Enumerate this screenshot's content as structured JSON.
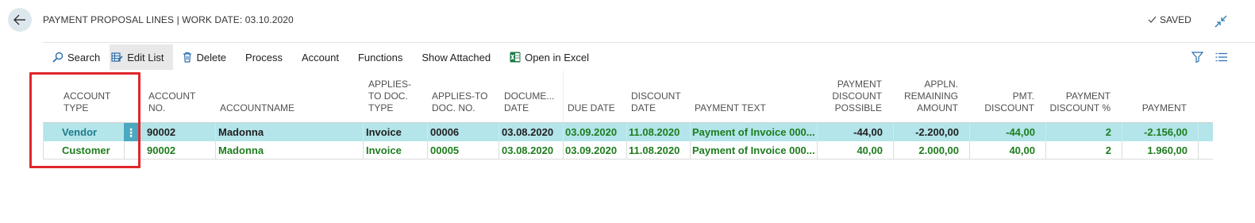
{
  "header": {
    "title": "PAYMENT PROPOSAL LINES | WORK DATE: 03.10.2020",
    "saved_label": "SAVED"
  },
  "toolbar": {
    "search": "Search",
    "edit_list": "Edit List",
    "delete": "Delete",
    "process": "Process",
    "account": "Account",
    "functions": "Functions",
    "show_attached": "Show Attached",
    "open_in_excel": "Open in Excel"
  },
  "columns": {
    "account_type": [
      "ACCOUNT",
      "TYPE"
    ],
    "account_no": [
      "ACCOUNT",
      "NO."
    ],
    "account_name": [
      "ACCOUNTNAME"
    ],
    "applies_to_doc_type": [
      "APPLIES-",
      "TO DOC.",
      "TYPE"
    ],
    "applies_to_doc_no": [
      "APPLIES-TO",
      "DOC. NO."
    ],
    "document_date": [
      "DOCUME...",
      "DATE"
    ],
    "due_date": [
      "DUE DATE"
    ],
    "discount_date": [
      "DISCOUNT",
      "DATE"
    ],
    "payment_text": [
      "PAYMENT TEXT"
    ],
    "payment_discount_possible": [
      "PAYMENT",
      "DISCOUNT",
      "POSSIBLE"
    ],
    "appln_remaining_amount": [
      "APPLN.",
      "REMAINING",
      "AMOUNT"
    ],
    "pmt_discount": [
      "PMT.",
      "DISCOUNT"
    ],
    "payment_discount_pct": [
      "PAYMENT",
      "DISCOUNT %"
    ],
    "payment": [
      "PAYMENT"
    ]
  },
  "rows": [
    {
      "account_type": "Vendor",
      "account_no": "90002",
      "account_name": "Madonna",
      "applies_to_doc_type": "Invoice",
      "applies_to_doc_no": "00006",
      "document_date": "03.08.2020",
      "due_date": "03.09.2020",
      "discount_date": "11.08.2020",
      "payment_text": "Payment of Invoice 000...",
      "payment_discount_possible": "-44,00",
      "appln_remaining_amount": "-2.200,00",
      "pmt_discount": "-44,00",
      "payment_discount_pct": "2",
      "payment": "-2.156,00"
    },
    {
      "account_type": "Customer",
      "account_no": "90002",
      "account_name": "Madonna",
      "applies_to_doc_type": "Invoice",
      "applies_to_doc_no": "00005",
      "document_date": "03.08.2020",
      "due_date": "03.09.2020",
      "discount_date": "11.08.2020",
      "payment_text": "Payment of Invoice 000...",
      "payment_discount_possible": "40,00",
      "appln_remaining_amount": "2.000,00",
      "pmt_discount": "40,00",
      "payment_discount_pct": "2",
      "payment": "1.960,00"
    }
  ],
  "colors": {
    "selected_row": "#b3e5ea",
    "link_teal": "#1f7a8c",
    "green": "#1e7d1e",
    "dark": "#212121",
    "highlight_red": "#e0262c",
    "excel_green": "#1d7a45"
  },
  "icons": [
    "back-arrow-icon",
    "check-icon",
    "collapse-icon",
    "search-icon",
    "edit-list-icon",
    "trash-icon",
    "excel-icon",
    "filter-icon",
    "list-icon",
    "more-dots-icon"
  ]
}
